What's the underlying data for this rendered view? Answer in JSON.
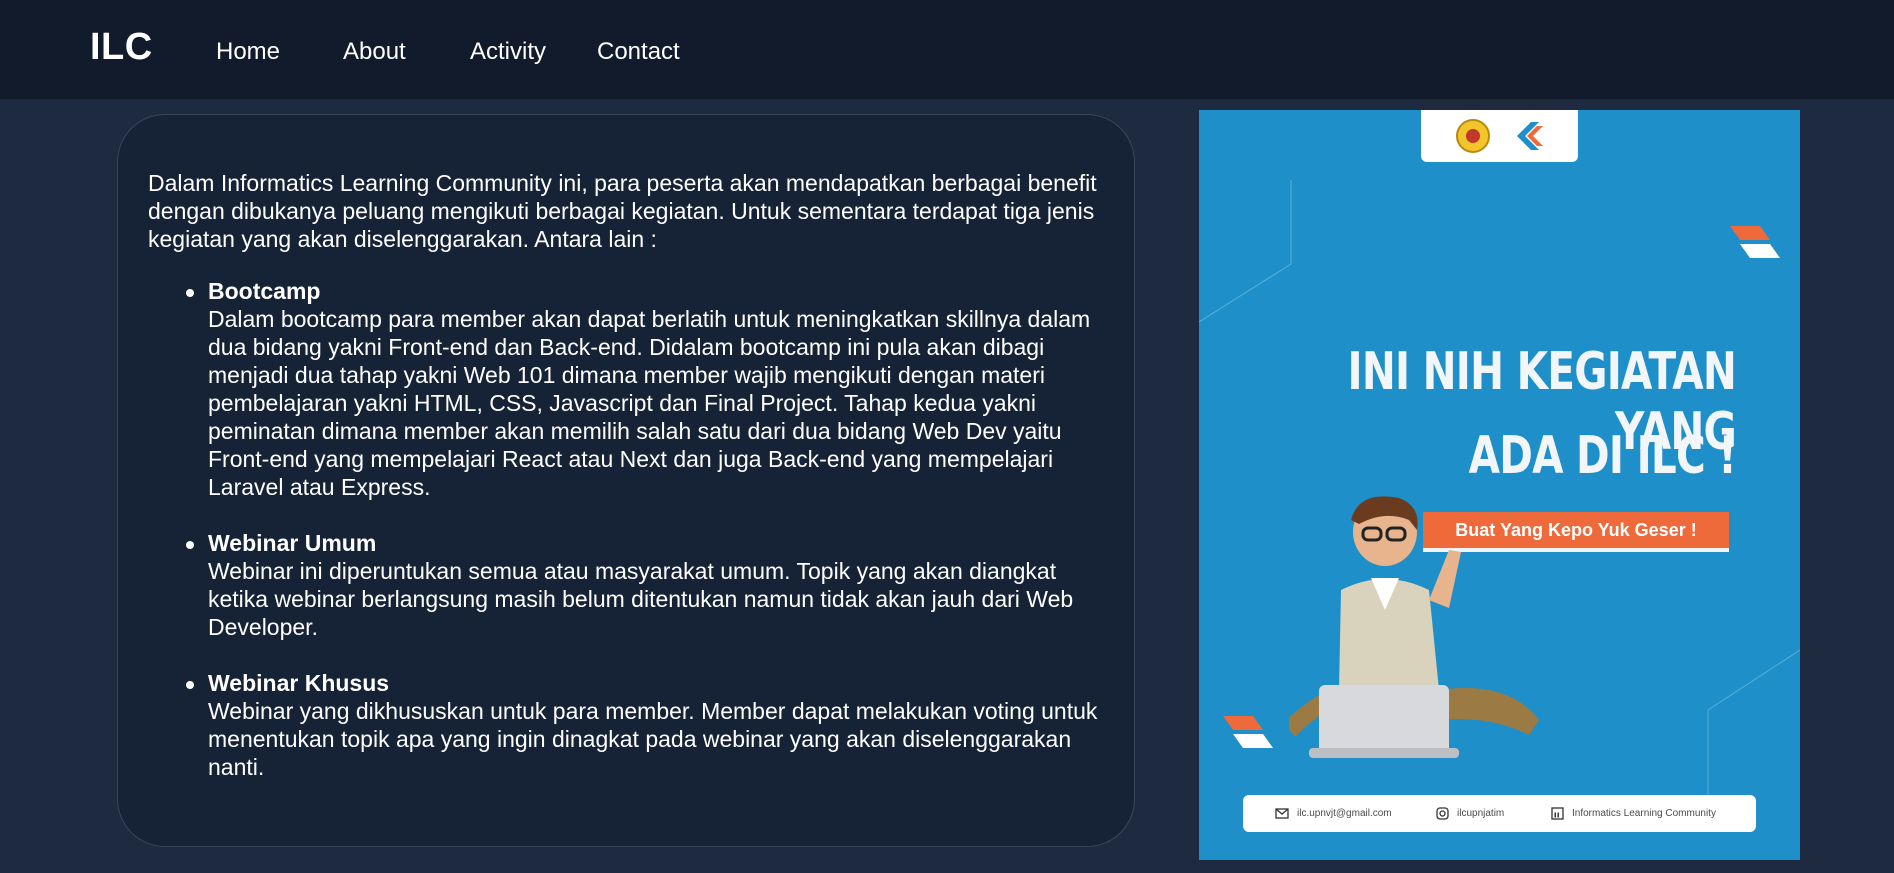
{
  "nav": {
    "brand": "ILC",
    "links": [
      "Home",
      "About",
      "Activity",
      "Contact"
    ]
  },
  "content": {
    "intro": "Dalam Informatics Learning Community ini, para peserta akan mendapatkan berbagai benefit dengan dibukanya peluang mengikuti berbagai kegiatan. Untuk sementara terdapat tiga jenis kegiatan yang akan diselenggarakan. Antara lain :",
    "activities": [
      {
        "title": "Bootcamp",
        "desc": "Dalam bootcamp para member akan dapat berlatih untuk meningkatkan skillnya dalam dua bidang yakni Front-end dan Back-end. Didalam bootcamp ini pula akan dibagi menjadi dua tahap yakni Web 101 dimana member wajib mengikuti dengan materi pembelajaran yakni HTML, CSS, Javascript dan Final Project. Tahap kedua yakni peminatan dimana member akan memilih salah satu dari dua bidang Web Dev yaitu Front-end yang mempelajari React atau Next dan juga Back-end yang mempelajari Laravel atau Express."
      },
      {
        "title": "Webinar Umum",
        "desc": "Webinar ini diperuntukan semua atau masyarakat umum. Topik yang akan diangkat ketika webinar berlangsung masih belum ditentukan namun tidak akan jauh dari Web Developer."
      },
      {
        "title": "Webinar Khusus",
        "desc": "Webinar yang dikhususkan untuk para member. Member dapat melakukan voting untuk menentukan topik apa yang ingin dinagkat pada webinar yang akan diselenggarakan nanti."
      }
    ]
  },
  "poster": {
    "headline_line1": "INI NIH KEGIATAN YANG",
    "headline_line2": "ADA DI ILC !",
    "cta": "Buat Yang Kepo Yuk Geser !",
    "footer": {
      "email": "ilc.upnvjt@gmail.com",
      "instagram": "ilcupnjatim",
      "linkedin": "Informatics Learning Community"
    }
  },
  "colors": {
    "page_bg": "#1e2a3f",
    "navbar_bg": "#111b2b",
    "card_bg": "#162236",
    "poster_bg": "#1f8fc9",
    "accent_orange": "#ee6a3b"
  },
  "icons": [
    "mail-icon",
    "instagram-icon",
    "linkedin-icon",
    "university-seal-logo",
    "ilc-logo"
  ]
}
